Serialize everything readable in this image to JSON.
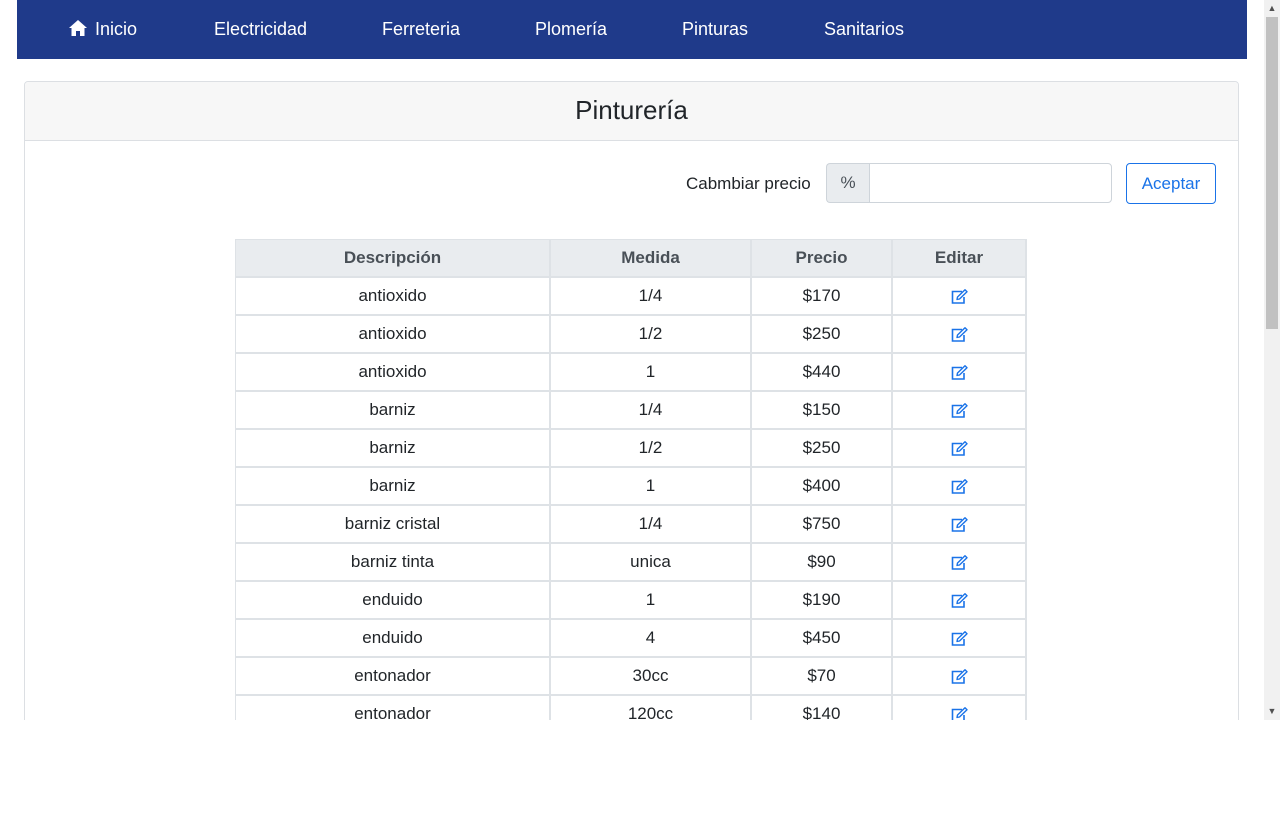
{
  "nav": {
    "items": [
      {
        "label": "Inicio",
        "icon": "home-icon"
      },
      {
        "label": "Electricidad"
      },
      {
        "label": "Ferreteria"
      },
      {
        "label": "Plomería"
      },
      {
        "label": "Pinturas"
      },
      {
        "label": "Sanitarios"
      }
    ]
  },
  "card": {
    "title": "Pinturería"
  },
  "price_change": {
    "label": "Cabmbiar precio",
    "addon": "%",
    "value": "",
    "placeholder": "",
    "accept_label": "Aceptar"
  },
  "table": {
    "headers": [
      "Descripción",
      "Medida",
      "Precio",
      "Editar"
    ],
    "rows": [
      {
        "descripcion": "antioxido",
        "medida": "1/4",
        "precio": "$170"
      },
      {
        "descripcion": "antioxido",
        "medida": "1/2",
        "precio": "$250"
      },
      {
        "descripcion": "antioxido",
        "medida": "1",
        "precio": "$440"
      },
      {
        "descripcion": "barniz",
        "medida": "1/4",
        "precio": "$150"
      },
      {
        "descripcion": "barniz",
        "medida": "1/2",
        "precio": "$250"
      },
      {
        "descripcion": "barniz",
        "medida": "1",
        "precio": "$400"
      },
      {
        "descripcion": "barniz cristal",
        "medida": "1/4",
        "precio": "$750"
      },
      {
        "descripcion": "barniz tinta",
        "medida": "unica",
        "precio": "$90"
      },
      {
        "descripcion": "enduido",
        "medida": "1",
        "precio": "$190"
      },
      {
        "descripcion": "enduido",
        "medida": "4",
        "precio": "$450"
      },
      {
        "descripcion": "entonador",
        "medida": "30cc",
        "precio": "$70"
      },
      {
        "descripcion": "entonador",
        "medida": "120cc",
        "precio": "$140"
      }
    ]
  },
  "colors": {
    "navbar": "#1f3a8a",
    "accent": "#1a73e8"
  }
}
